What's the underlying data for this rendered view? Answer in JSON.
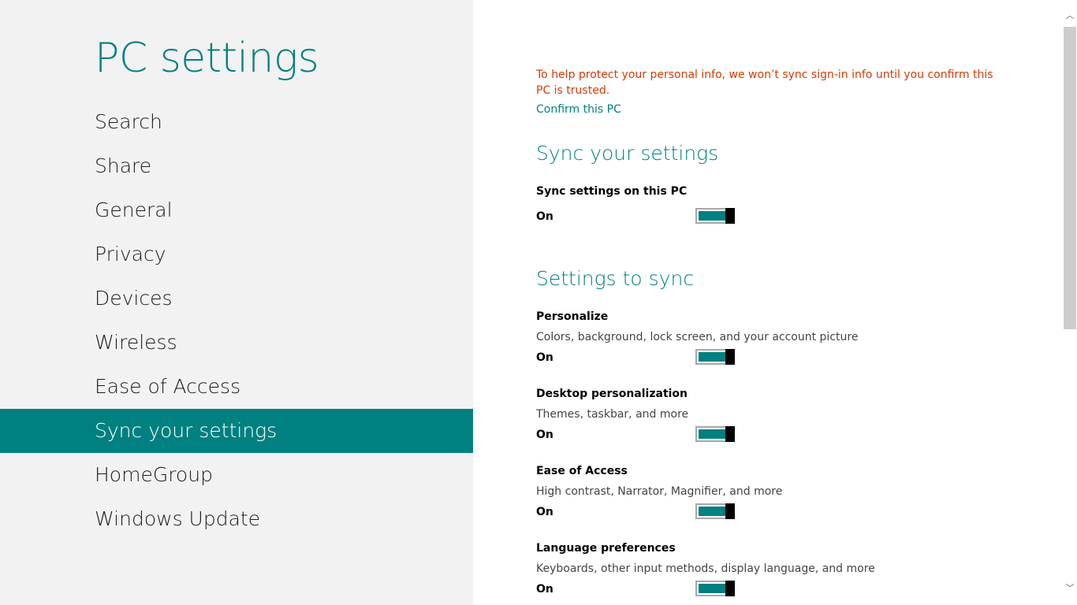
{
  "app_title": "PC settings",
  "nav": {
    "items": [
      {
        "label": "Search"
      },
      {
        "label": "Share"
      },
      {
        "label": "General"
      },
      {
        "label": "Privacy"
      },
      {
        "label": "Devices"
      },
      {
        "label": "Wireless"
      },
      {
        "label": "Ease of Access"
      },
      {
        "label": "Sync your settings"
      },
      {
        "label": "HomeGroup"
      },
      {
        "label": "Windows Update"
      }
    ],
    "selected": "Sync your settings"
  },
  "main": {
    "warning": "To help protect your personal info, we won’t sync sign-in info until you confirm this PC is trusted.",
    "confirm_link": "Confirm this PC",
    "sync_section": {
      "heading": "Sync your settings",
      "setting": {
        "label": "Sync settings on this PC",
        "state": "On"
      }
    },
    "settings_to_sync": {
      "heading": "Settings to sync",
      "items": [
        {
          "label": "Personalize",
          "description": "Colors, background, lock screen, and your account picture",
          "state": "On"
        },
        {
          "label": "Desktop personalization",
          "description": "Themes, taskbar, and more",
          "state": "On"
        },
        {
          "label": "Ease of Access",
          "description": "High contrast, Narrator, Magnifier, and more",
          "state": "On"
        },
        {
          "label": "Language preferences",
          "description": "Keyboards, other input methods, display language, and more",
          "state": "On"
        }
      ]
    }
  },
  "scrollbar": {
    "up_glyph": "︿",
    "down_glyph": "﹀"
  },
  "colors": {
    "accent": "#008080",
    "warning": "#d83b01",
    "left_bg": "#f2f2f2",
    "toggle_thumb": "#000000"
  }
}
